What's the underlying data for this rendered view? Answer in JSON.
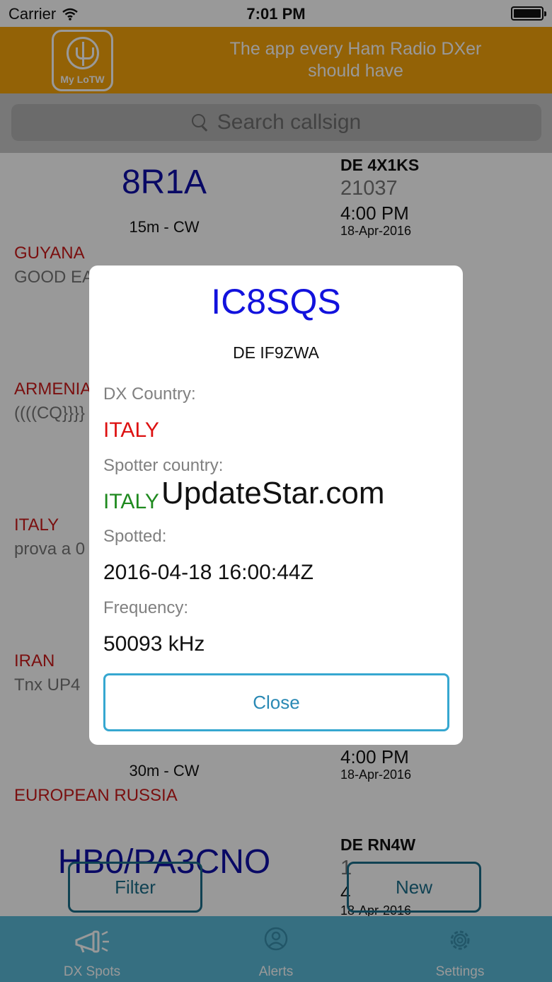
{
  "status_bar": {
    "carrier": "Carrier",
    "time": "7:01 PM"
  },
  "banner": {
    "logo_text": "My LoTW",
    "tagline_line1": "The app every Ham Radio DXer",
    "tagline_line2": "should have",
    "color": "#f6a30a"
  },
  "search": {
    "placeholder": "Search callsign",
    "icon": "search-icon"
  },
  "spots": [
    {
      "call": "8R1A",
      "band_mode": "15m - CW",
      "spotter": "DE 4X1KS",
      "freq": "21037",
      "time": "4:00 PM",
      "date": "18-Apr-2016",
      "country": "GUYANA",
      "comment": "GOOD EA"
    },
    {
      "country": "ARMENIA",
      "comment": "((((CQ}}}}"
    },
    {
      "country": "ITALY",
      "comment": "prova a 0"
    },
    {
      "country": "IRAN",
      "comment": "Tnx UP4"
    },
    {
      "band_mode": "30m - CW",
      "time": "4:00 PM",
      "date": "18-Apr-2016",
      "country": "EUROPEAN RUSSIA"
    },
    {
      "call": "HB0/PA3CNO",
      "spotter": "DE RN4W",
      "freq": "1",
      "time": "4",
      "date": "18-Apr-2016"
    }
  ],
  "buttons": {
    "filter": "Filter",
    "new": "New"
  },
  "tabs": [
    {
      "label": "DX Spots",
      "icon": "megaphone-icon",
      "active": true
    },
    {
      "label": "Alerts",
      "icon": "alert-person-icon",
      "active": false
    },
    {
      "label": "Settings",
      "icon": "gear-icon",
      "active": false
    }
  ],
  "modal": {
    "call": "IC8SQS",
    "spotter": "DE IF9ZWA",
    "dx_country_label": "DX Country:",
    "dx_country": "ITALY",
    "spotter_country_label": "Spotter country:",
    "spotter_country": "ITALY",
    "spotted_label": "Spotted:",
    "spotted": "2016-04-18 16:00:44Z",
    "frequency_label": "Frequency:",
    "frequency": "50093 kHz",
    "close_label": "Close"
  },
  "watermark": "UpdateStar.com"
}
